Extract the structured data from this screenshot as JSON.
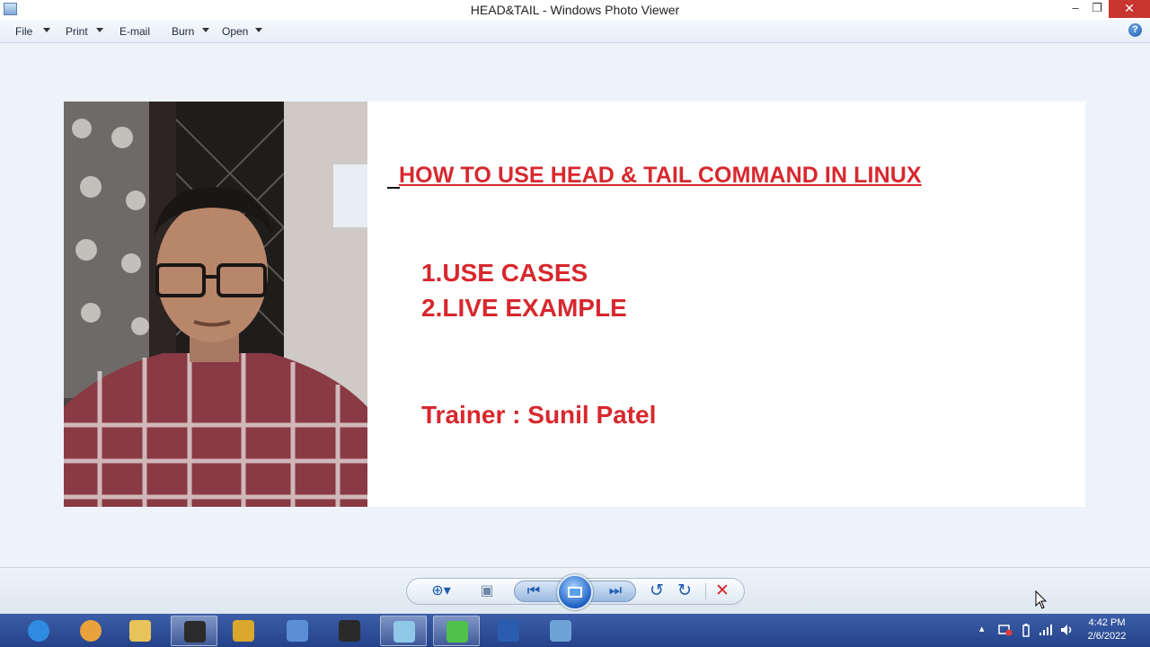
{
  "window": {
    "title": "HEAD&TAIL - Windows Photo Viewer",
    "min_glyph": "–",
    "max_glyph": "❐",
    "close_glyph": "✕"
  },
  "menu": {
    "file": "File",
    "print": "Print",
    "email": "E-mail",
    "burn": "Burn",
    "open": "Open",
    "help_glyph": "?"
  },
  "slide": {
    "title": "HOW TO USE HEAD & TAIL COMMAND IN LINUX",
    "items": [
      "1.USE CASES",
      "2.LIVE EXAMPLE"
    ],
    "trainer": "Trainer : Sunil Patel"
  },
  "controls": {
    "zoom_glyph": "⊕▾",
    "fit_glyph": "▣",
    "prev_glyph": "⏮",
    "next_glyph": "⏭",
    "rotate_ccw_glyph": "↺",
    "rotate_cw_glyph": "↻",
    "delete_glyph": "✕"
  },
  "taskbar": {
    "apps": [
      {
        "icon": "internet-explorer-icon",
        "color": "#2f8be0"
      },
      {
        "icon": "chrome-icon",
        "color": "#e9a23b"
      },
      {
        "icon": "file-explorer-icon",
        "color": "#e8c35a"
      },
      {
        "icon": "obs-icon",
        "color": "#2b2b2b"
      },
      {
        "icon": "explorer-window-icon",
        "color": "#d9a72c"
      },
      {
        "icon": "control-panel-icon",
        "color": "#5a8fd6"
      },
      {
        "icon": "command-prompt-icon",
        "color": "#2a2a2a"
      },
      {
        "icon": "notepad-icon",
        "color": "#8fc7e8"
      },
      {
        "icon": "screen-recorder-icon",
        "color": "#4fc24a"
      },
      {
        "icon": "word-icon",
        "color": "#2a5db0"
      },
      {
        "icon": "photo-viewer-icon",
        "color": "#6ea3d8"
      }
    ],
    "tray_caret": "▴",
    "time": "4:42 PM",
    "date": "2/6/2022"
  }
}
